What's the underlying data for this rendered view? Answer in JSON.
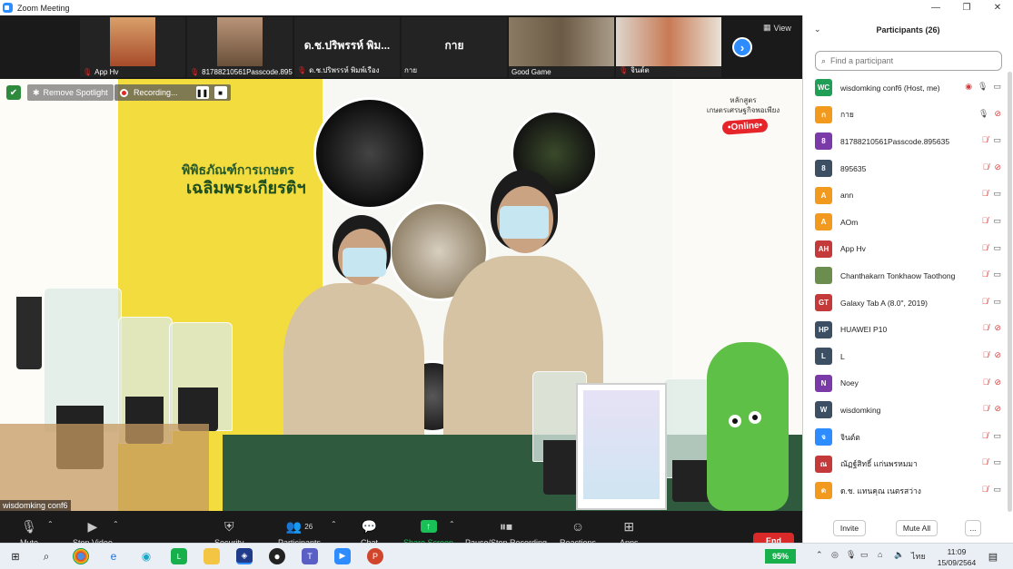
{
  "window": {
    "title": "Zoom Meeting",
    "minimize_glyph": "—",
    "restore_glyph": "❐",
    "close_glyph": "✕"
  },
  "thumbnails": [
    {
      "name": "App Hv",
      "video": true,
      "color": "#a84b2a"
    },
    {
      "name": "81788210561Passcode.895635",
      "video": true,
      "color": "#6a5039"
    },
    {
      "name": "ด.ช.ปริพรรห์ พิมพ์เรือง",
      "video": false,
      "display": "ด.ช.ปริพรรห์ พิม..."
    },
    {
      "name": "กาย",
      "video": false,
      "display": "กาย"
    },
    {
      "name": "Good Game",
      "video": true,
      "color": "#6b5a45"
    },
    {
      "name": "จินต์ต",
      "video": true,
      "color": "#c87a55"
    }
  ],
  "view_label": "View",
  "next_arrow": "›",
  "spotlight": {
    "remove_label": "Remove Spotlight",
    "recording_label": "Recording...",
    "pause_glyph": "❚❚",
    "stop_glyph": "■",
    "speaker_name": "wisdomking conf6"
  },
  "scene": {
    "poster_line1": "พิพิธภัณฑ์การเกษตร",
    "poster_line2": "เฉลิมพระเกียรติฯ",
    "course_line1": "หลักสูตร",
    "course_line2": "เกษตรเศรษฐกิจพอเพียง",
    "online_badge": "•Online•"
  },
  "toolbar": {
    "mute": "Mute",
    "stop_video": "Stop Video",
    "security": "Security",
    "participants": "Participants",
    "participants_count": "26",
    "chat": "Chat",
    "share_screen": "Share Screen",
    "pause_stop": "Pause/Stop Recording",
    "reactions": "Reactions",
    "apps": "Apps",
    "end": "End"
  },
  "panel": {
    "title": "Participants (26)",
    "search_placeholder": "Find a participant",
    "invite": "Invite",
    "mute_all": "Mute All",
    "more": "...",
    "participants": [
      {
        "initials": "WC",
        "name": "wisdomking conf6 (Host, me)",
        "color": "#1f9e55",
        "mic": "on",
        "video": "on",
        "sharing": true
      },
      {
        "initials": "ก",
        "name": "กาย",
        "color": "#f29a1e",
        "mic": "on",
        "video": "off"
      },
      {
        "initials": "8",
        "name": "81788210561Passcode.895635",
        "color": "#7a3aa8",
        "mic": "off",
        "video": "on"
      },
      {
        "initials": "8",
        "name": "895635",
        "color": "#3d4f63",
        "mic": "off",
        "video": "off"
      },
      {
        "initials": "A",
        "name": "ann",
        "color": "#f29a1e",
        "mic": "off",
        "video": "on"
      },
      {
        "initials": "A",
        "name": "AOm",
        "color": "#f29a1e",
        "mic": "off",
        "video": "on"
      },
      {
        "initials": "AH",
        "name": "App Hv",
        "color": "#c43a3a",
        "mic": "off",
        "video": "on"
      },
      {
        "initials": "",
        "name": "Chanthakarn Tonkhaow Taothong",
        "color": "#6b8e4e",
        "mic": "off",
        "video": "on"
      },
      {
        "initials": "GT",
        "name": "Galaxy Tab A (8.0\", 2019)",
        "color": "#c43a3a",
        "mic": "off",
        "video": "on"
      },
      {
        "initials": "HP",
        "name": "HUAWEI P10",
        "color": "#3d4f63",
        "mic": "off",
        "video": "off"
      },
      {
        "initials": "L",
        "name": "L",
        "color": "#3d4f63",
        "mic": "off",
        "video": "off"
      },
      {
        "initials": "N",
        "name": "Noey",
        "color": "#7a3aa8",
        "mic": "off",
        "video": "off"
      },
      {
        "initials": "W",
        "name": "wisdomking",
        "color": "#3d4f63",
        "mic": "off",
        "video": "off"
      },
      {
        "initials": "จ",
        "name": "จินต์ต",
        "color": "#2d8cff",
        "mic": "off",
        "video": "on"
      },
      {
        "initials": "ณ",
        "name": "ณัฏฐ์สิทธิ์ แก่นพรหมมา",
        "color": "#c43a3a",
        "mic": "off",
        "video": "on"
      },
      {
        "initials": "ด",
        "name": "ด.ช. แทนคุณ เนตรสว่าง",
        "color": "#f29a1e",
        "mic": "off",
        "video": "on"
      }
    ]
  },
  "taskbar": {
    "battery": "95%",
    "lang": "ไทย",
    "time": "11:09",
    "date": "15/09/2564"
  }
}
